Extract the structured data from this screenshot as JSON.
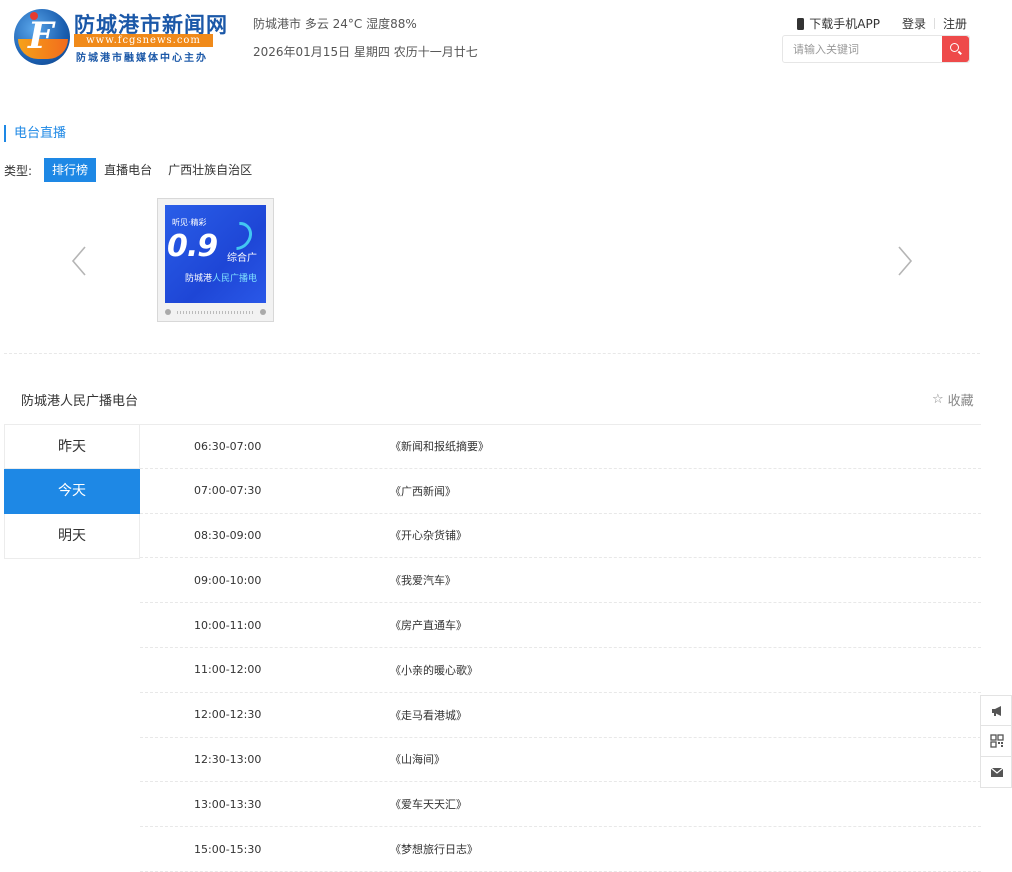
{
  "header": {
    "logo_title": "防城港市新闻网",
    "logo_url": "www.fcgsnews.com",
    "logo_sub": "防城港市融媒体中心主办",
    "weather": "防城港市 多云 24°C 湿度88%",
    "date": "2026年01月15日 星期四 农历十一月廿七",
    "download_app": "下载手机APP",
    "login": "登录",
    "register": "注册",
    "search_placeholder": "请输入关键词"
  },
  "section": {
    "title": "电台直播",
    "type_label": "类型:",
    "types": [
      "排行榜",
      "直播电台",
      "广西壮族自治区"
    ]
  },
  "carousel": {
    "station_screen": {
      "top_text": "听见·精彩",
      "freq": "0.9",
      "zh": "综合广",
      "name_plain": "防城港",
      "name_highlight": "人民广播电"
    }
  },
  "station": {
    "name": "防城港人民广播电台",
    "collect": "收藏"
  },
  "days": [
    "昨天",
    "今天",
    "明天"
  ],
  "schedule": [
    {
      "time": "06:30-07:00",
      "program": "《新闻和报纸摘要》"
    },
    {
      "time": "07:00-07:30",
      "program": "《广西新闻》"
    },
    {
      "time": "08:30-09:00",
      "program": "《开心杂货铺》"
    },
    {
      "time": "09:00-10:00",
      "program": "《我爱汽车》"
    },
    {
      "time": "10:00-11:00",
      "program": "《房产直通车》"
    },
    {
      "time": "11:00-12:00",
      "program": "《小亲的暖心歌》"
    },
    {
      "time": "12:00-12:30",
      "program": "《走马看港城》"
    },
    {
      "time": "12:30-13:00",
      "program": "《山海间》"
    },
    {
      "time": "13:00-13:30",
      "program": "《爱车天天汇》"
    },
    {
      "time": "15:00-15:30",
      "program": "《梦想旅行日志》"
    }
  ],
  "colors": {
    "accent": "#1e88e5",
    "search_button": "#ee4a4a",
    "logo_blue": "#1b58a8",
    "logo_orange": "#f08a1a"
  },
  "float_icons": [
    "megaphone-icon",
    "qrcode-icon",
    "mail-icon"
  ]
}
